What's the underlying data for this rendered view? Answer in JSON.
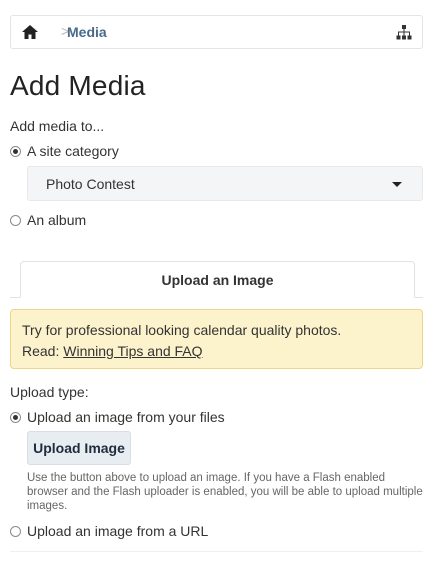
{
  "breadcrumb": {
    "separator": ">",
    "current": "Media"
  },
  "page_title": "Add Media",
  "add_to": {
    "label": "Add media to...",
    "options": [
      {
        "label": "A site category",
        "checked": true
      },
      {
        "label": "An album",
        "checked": false
      }
    ],
    "category_select": {
      "value": "Photo Contest"
    }
  },
  "tab": {
    "label": "Upload an Image"
  },
  "alert": {
    "line1": "Try for professional looking calendar quality photos.",
    "read_prefix": "Read:",
    "link": "Winning Tips and FAQ"
  },
  "upload_type": {
    "label": "Upload type:",
    "options": [
      {
        "label": "Upload an image from your files",
        "checked": true
      },
      {
        "label": "Upload an image from a URL",
        "checked": false
      }
    ],
    "button": "Upload Image",
    "help": "Use the button above to upload an image. If you have a Flash enabled browser and the Flash uploader is enabled, you will be able to upload multiple images."
  },
  "colors": {
    "link": "#4a6a8c",
    "alert_bg": "#fcf3cc",
    "alert_border": "#ecd688",
    "select_bg": "#f3f5f7"
  }
}
